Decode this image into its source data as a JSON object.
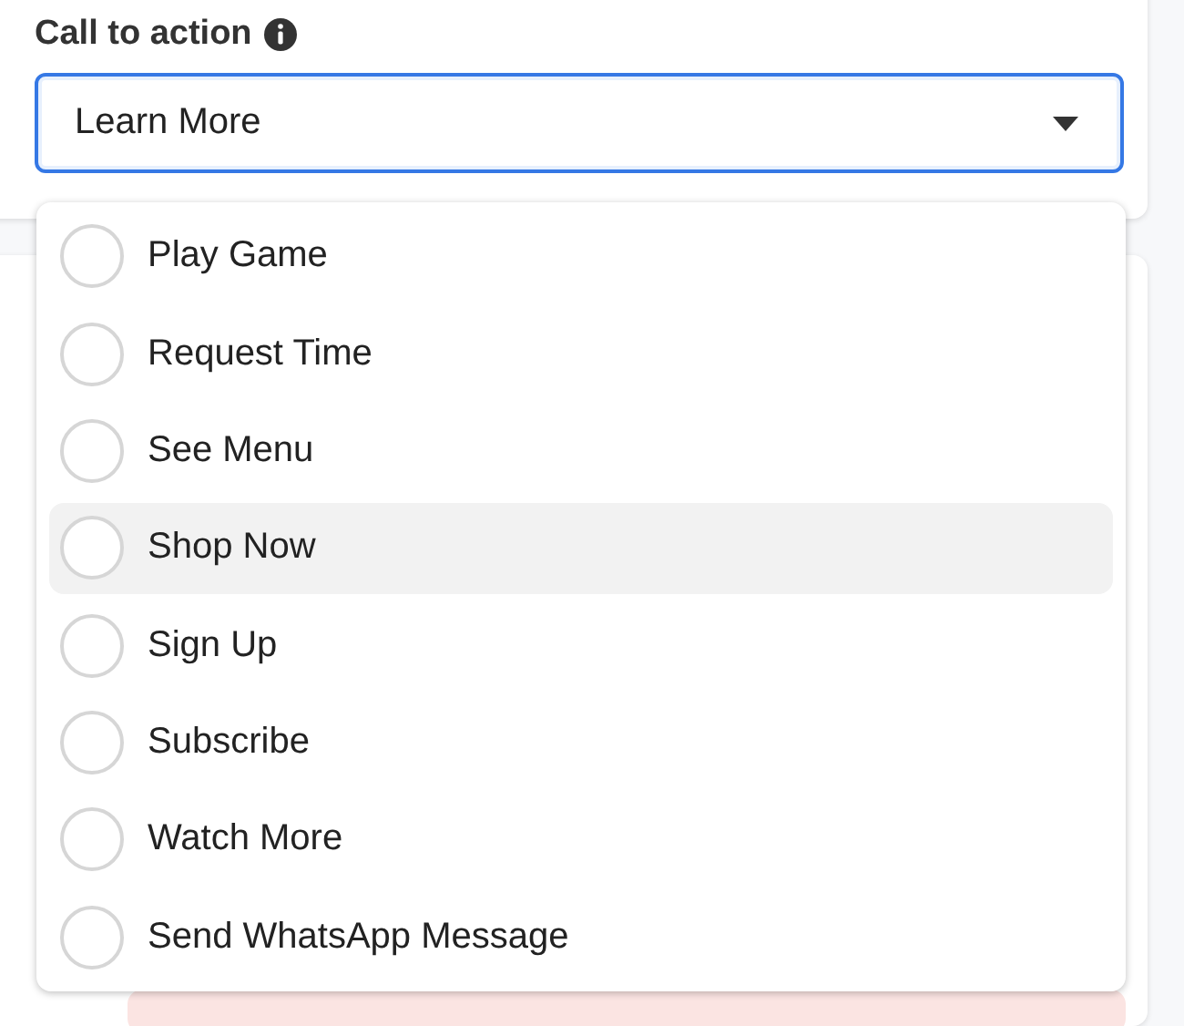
{
  "field": {
    "label": "Call to action",
    "value": "Learn More",
    "focused": true
  },
  "dropdown": {
    "options": [
      {
        "label": "Play Game",
        "checked": false,
        "highlighted": false
      },
      {
        "label": "Request Time",
        "checked": false,
        "highlighted": false
      },
      {
        "label": "See Menu",
        "checked": false,
        "highlighted": false
      },
      {
        "label": "Shop Now",
        "checked": false,
        "highlighted": true
      },
      {
        "label": "Sign Up",
        "checked": false,
        "highlighted": false
      },
      {
        "label": "Subscribe",
        "checked": false,
        "highlighted": false
      },
      {
        "label": "Watch More",
        "checked": false,
        "highlighted": false
      },
      {
        "label": "Send WhatsApp Message",
        "checked": false,
        "highlighted": false
      }
    ]
  }
}
